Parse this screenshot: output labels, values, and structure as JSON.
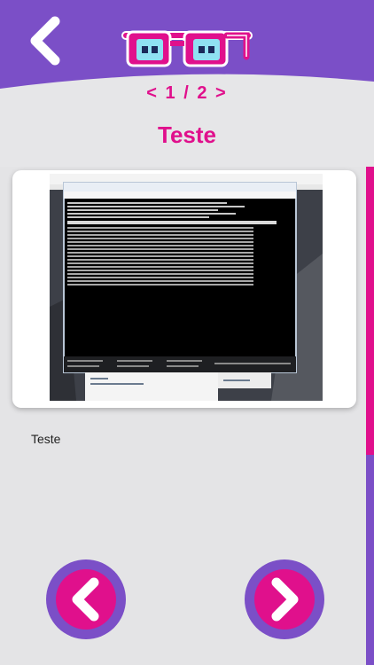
{
  "header": {
    "back_icon": "chevron-left-icon",
    "logo_icon": "glasses-logo-icon",
    "pager": "< 1 / 2 >"
  },
  "page": {
    "title": "Teste",
    "caption": "Teste"
  },
  "colors": {
    "accent": "#e0108c",
    "purple": "#7b4fc7",
    "background": "#e6e6e8"
  },
  "nav": {
    "prev_icon": "chevron-left-icon",
    "next_icon": "chevron-right-icon"
  }
}
